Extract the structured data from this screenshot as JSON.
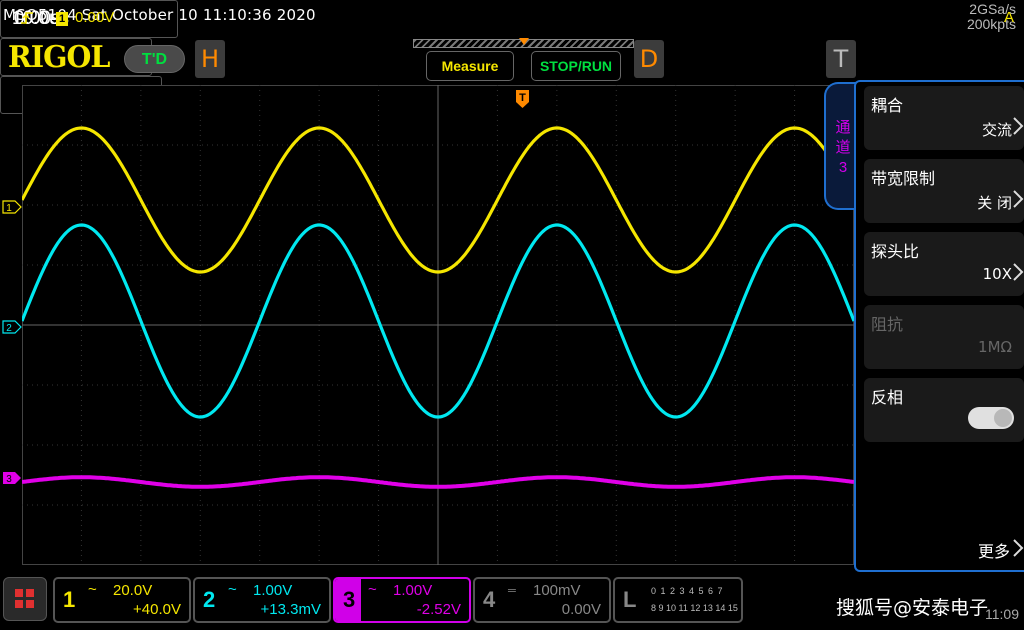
{
  "status_line": "MSO5104  Sat October 10 11:10:36 2020",
  "toolbar": {
    "logo": "RIGOL",
    "td_badge": "T'D",
    "horizontal": {
      "tag": "H",
      "timebase": "10.0us",
      "sample_rate": "2GSa/s",
      "memory_depth": "200kpts"
    },
    "measure_label": "Measure",
    "stop_run_label": "STOP/RUN",
    "delay": {
      "tag": "D",
      "value": "0.00s"
    },
    "trigger": {
      "tag": "T",
      "source": "1",
      "level": "0.00V",
      "mode": "A",
      "edge_icon": "rising-edge-icon"
    }
  },
  "channel_tab": "通道3",
  "menu": {
    "items": [
      {
        "title": "耦合",
        "value": "交流"
      },
      {
        "title": "带宽限制",
        "value": "关 闭"
      },
      {
        "title": "探头比",
        "value": "10X"
      },
      {
        "title": "阻抗",
        "value": "1MΩ"
      },
      {
        "title": "反相",
        "value": ""
      }
    ],
    "more_label": "更多",
    "invert_on": false
  },
  "channels": [
    {
      "num": "1",
      "coupling_icon": "ac-coupling-icon",
      "scale": "20.0V",
      "offset": "+40.0V",
      "color": "#f5e600"
    },
    {
      "num": "2",
      "coupling_icon": "ac-coupling-icon",
      "scale": "1.00V",
      "offset": "+13.3mV",
      "color": "#00e8f0"
    },
    {
      "num": "3",
      "coupling_icon": "ac-coupling-icon",
      "scale": "1.00V",
      "offset": "-2.52V",
      "color": "#e000e8"
    },
    {
      "num": "4",
      "coupling_icon": "dc-coupling-icon",
      "scale": "100mV",
      "offset": "0.00V",
      "color": "#888888"
    }
  ],
  "logic": {
    "tag": "L",
    "row1": "0 1 2 3   4 5 6 7",
    "row2": "8 9 10 11 12 13 14 15"
  },
  "watermark": "搜狐号@安泰电子",
  "clock": "11:09",
  "waveforms": {
    "ch1": {
      "color": "#f5e600",
      "shape": "sine",
      "period_divisions": 4.0,
      "amplitude_divisions": 1.2
    },
    "ch2": {
      "color": "#00e8f0",
      "shape": "sine",
      "period_divisions": 4.0,
      "amplitude_divisions": 1.6
    },
    "ch3": {
      "color": "#e000e8",
      "shape": "sine",
      "period_divisions": 4.0,
      "amplitude_divisions": 0.08
    }
  }
}
